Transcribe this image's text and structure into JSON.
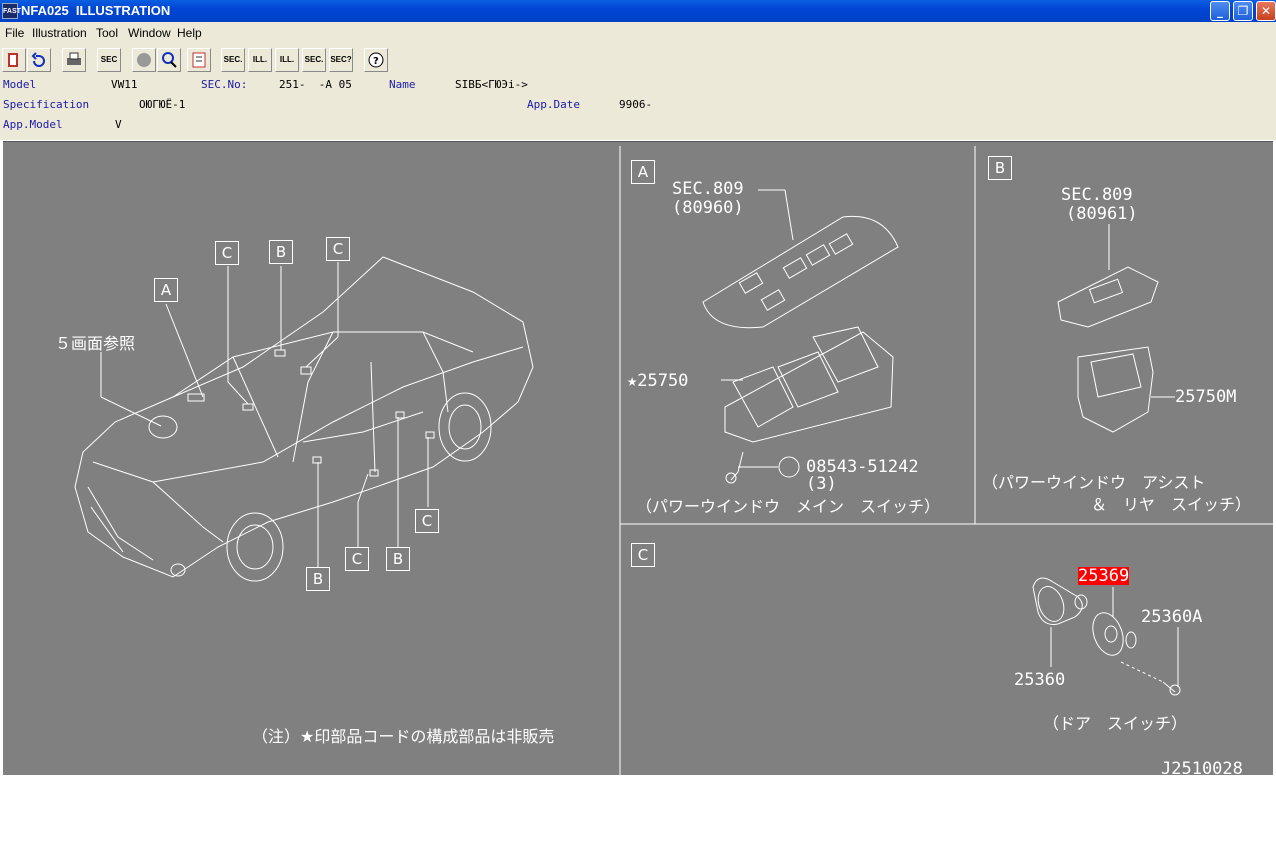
{
  "window": {
    "app_icon": "FAST",
    "title": "NFA025  ILLUSTRATION"
  },
  "menu": [
    "File",
    "Illustration",
    "Tool",
    "Window",
    "Help"
  ],
  "toolbar": {
    "buttons": [
      "book-icon",
      "undo-icon",
      "print-icon",
      "SEC",
      "circle-icon",
      "zoom-icon",
      "page-icon",
      "SEC.",
      "ILL.",
      "ILL.",
      "SEC.",
      "SEC?",
      "help-icon"
    ]
  },
  "info": {
    "model_label": "Model",
    "model_value": "VW11",
    "sec_label": "SEC.No:",
    "sec_value": "251-  -A 05",
    "name_label": "Name",
    "name_value": "SIBБ<ГЮЭi->",
    "spec_label": "Specification",
    "spec_value": "ОЮГЮЁ-1",
    "appdate_label": "App.Date",
    "appdate_value": "9906-",
    "appmodel_label": "App.Model",
    "appmodel_value": "V"
  },
  "illustration": {
    "ref_note": "５画面参照",
    "callouts": [
      "A",
      "C",
      "B",
      "C",
      "B",
      "C",
      "B",
      "C"
    ],
    "panel_a": {
      "box": "A",
      "sec_label": "SEC.809",
      "sec_code": "(80960)",
      "part_star": "★25750",
      "screw_part": "08543-51242",
      "screw_qty": "(3)",
      "caption": "（パワーウインドウ　メイン　スイッチ）"
    },
    "panel_b": {
      "box": "B",
      "sec_label": "SEC.809",
      "sec_code": "(80961)",
      "part": "25750M",
      "caption1": "（パワーウインドウ　アシスト",
      "caption2": "＆　リヤ　スイッチ）"
    },
    "panel_c": {
      "box": "C",
      "part_selected": "25369",
      "part_a": "25360A",
      "part_b": "25360",
      "caption": "（ドア　スイッチ）"
    },
    "note": "（注）★印部品コードの構成部品は非販売",
    "drawing_id": "J2510028"
  }
}
